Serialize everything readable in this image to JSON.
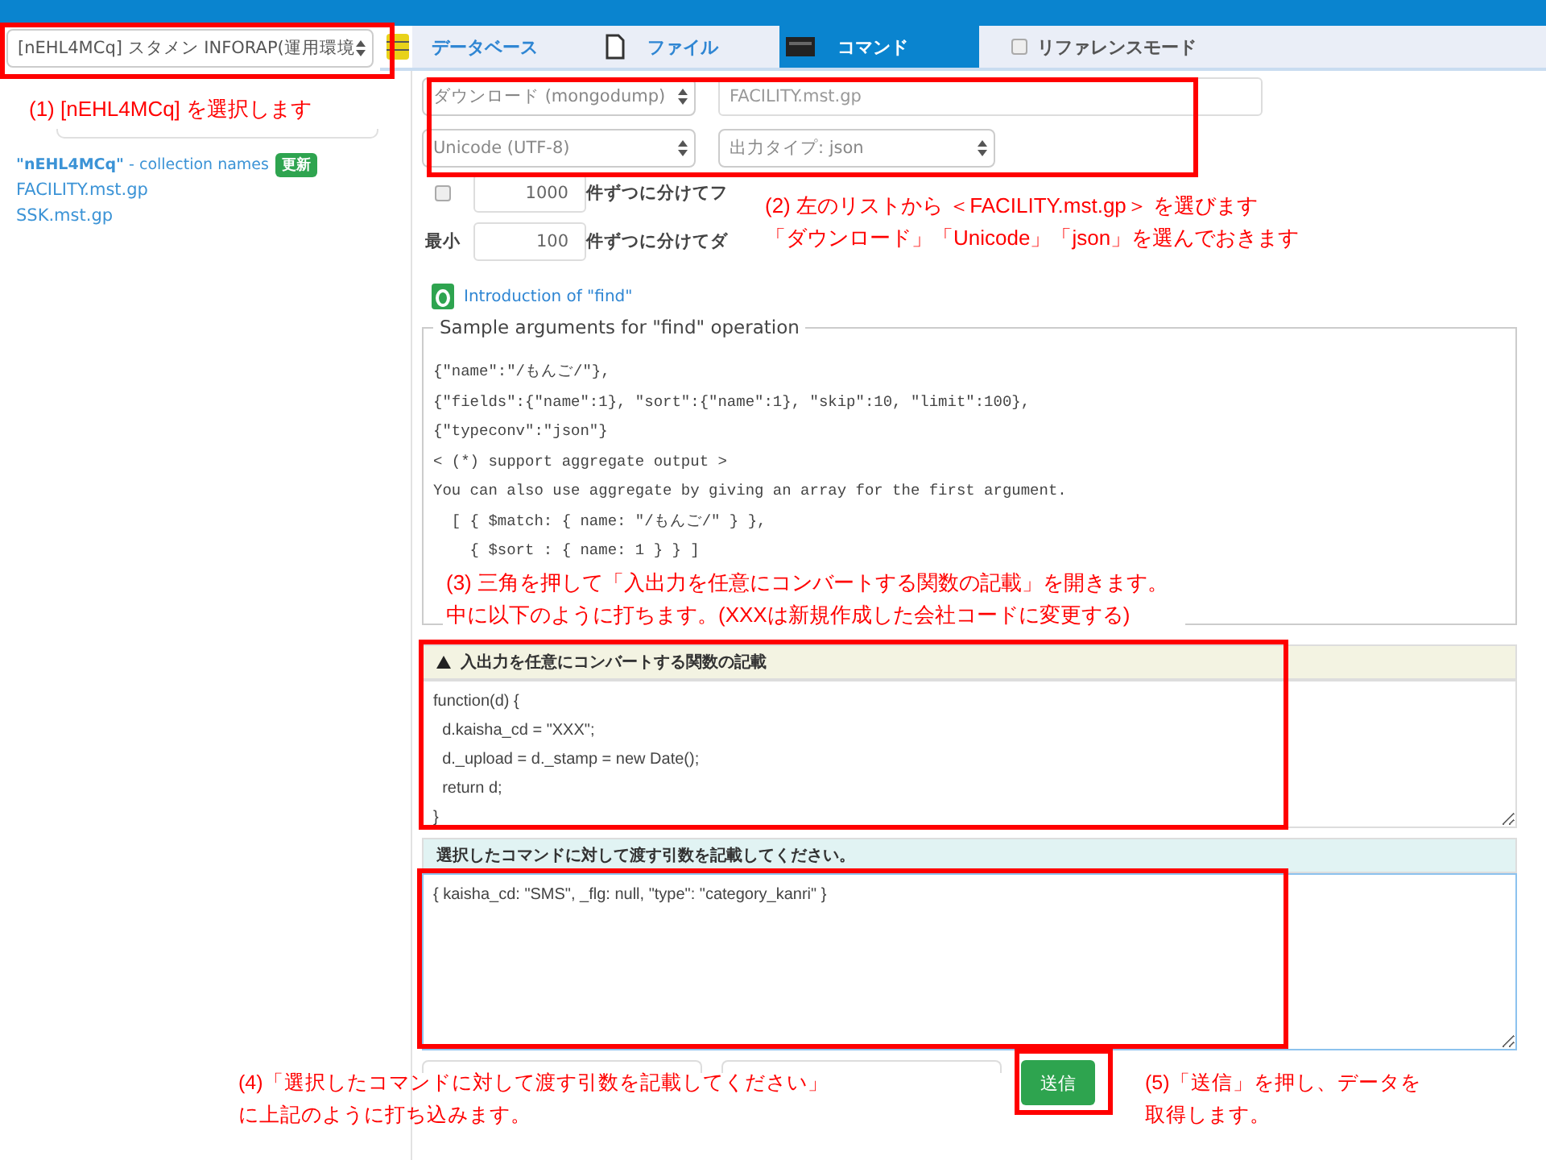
{
  "db_select": {
    "value": "[nEHL4MCq] スタメン INFORAP(運用環境"
  },
  "tabs": [
    {
      "kind": "database",
      "label": "データベース",
      "selected": false
    },
    {
      "kind": "file",
      "label": "ファイル",
      "selected": false
    },
    {
      "kind": "command",
      "label": "コマンド",
      "selected": true
    }
  ],
  "reference_mode": {
    "label": "リファレンスモード",
    "checked": false
  },
  "sidebar": {
    "header": "**\"nEHL4MCq\"** - collection names",
    "badge": "更新",
    "items": [
      "FACILITY.mst.gp",
      "SSK.mst.gp"
    ]
  },
  "form": {
    "command": "ダウンロード (mongodump)",
    "file": "FACILITY.mst.gp",
    "encoding": "Unicode (UTF-8)",
    "output_type": "出力タイプ: json",
    "split_rows": [
      {
        "kind": "checkbox",
        "checked": false,
        "value": "1000",
        "suffix": "件ずつに分けてフ"
      },
      {
        "kind": "label",
        "label": "最小",
        "value": "100",
        "suffix": "件ずつに分けてダ"
      }
    ]
  },
  "intro_link": "Introduction of \"find\"",
  "sample": {
    "legend": "Sample arguments for \"find\" operation",
    "lines": [
      "{\"name\":\"/もんご/\"},",
      "{\"fields\":{\"name\":1}, \"sort\":{\"name\":1}, \"skip\":10, \"limit\":100},",
      "{\"typeconv\":\"json\"}",
      "< (*) support aggregate output >",
      "You can also use aggregate by giving an array for the first argument.",
      "  [ { $match: { name: \"/もんご/\" } },",
      "    { $sort : { name: 1 } } ]"
    ]
  },
  "converter": {
    "title": "入出力を任意にコンバートする関数の記載",
    "expanded": true,
    "code": "function(d) {\n  d.kaisha_cd = \"XXX\";\n  d._upload = d._stamp = new Date();\n  return d;\n}"
  },
  "args": {
    "title": "選択したコマンドに対して渡す引数を記載してください。",
    "value": "{ kaisha_cd: \"SMS\", _flg: null, \"type\": \"category_kanri\" }"
  },
  "submit": "送信",
  "annotations": [
    {
      "lines": [
        "(1) [nEHL4MCq] を選択します"
      ]
    },
    {
      "lines": [
        "(2) 左のリストから ＜FACILITY.mst.gp＞ を選びます",
        "「ダウンロード」「Unicode」「json」を選んでおきます"
      ]
    },
    {
      "lines": [
        "(3) 三角を押して「入出力を任意にコンバートする関数の記載」を開きます。",
        "中に以下のように打ちます。(XXXは新規作成した会社コードに変更する)"
      ]
    },
    {
      "lines": [
        "(4)「選択したコマンドに対して渡す引数を記載してください」",
        "に上記のように打ち込みます。"
      ]
    },
    {
      "lines": [
        "(5)「送信」を押し、データを",
        "取得します。"
      ]
    }
  ]
}
